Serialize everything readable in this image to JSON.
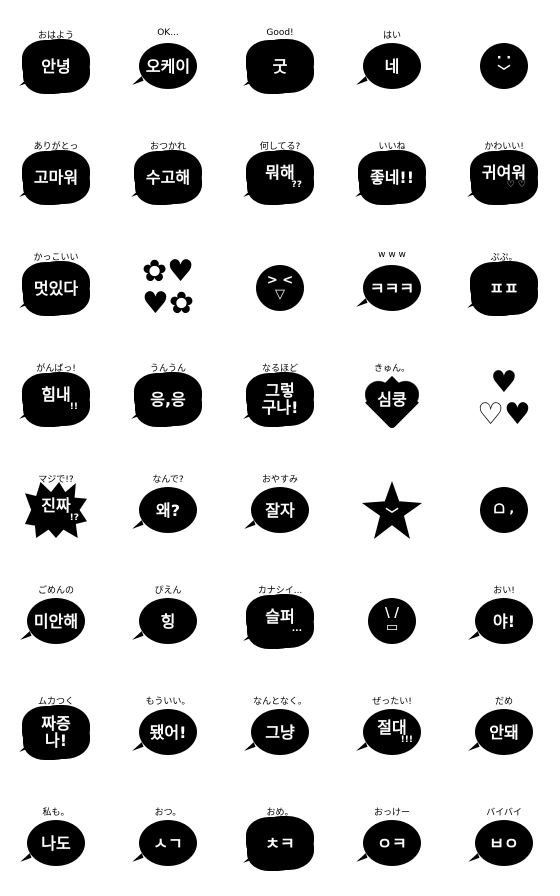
{
  "colors": {
    "ink": "#000000",
    "paper": "#ffffff"
  },
  "stickers": [
    {
      "caption": "おはよう",
      "text": "안녕",
      "sub": "",
      "shape": "cloud"
    },
    {
      "caption": "OK...",
      "text": "오케이",
      "sub": "",
      "shape": "round"
    },
    {
      "caption": "Good!",
      "text": "굿",
      "sub": "",
      "shape": "cloud"
    },
    {
      "caption": "はい",
      "text": "네",
      "sub": "",
      "shape": "round"
    },
    {
      "caption": "",
      "text": "",
      "sub": "",
      "shape": "face",
      "icon": "smile-face-icon",
      "glyph": "· ·\n﹀"
    },
    {
      "caption": "ありがとっ",
      "text": "고마워",
      "sub": "",
      "shape": "cloud"
    },
    {
      "caption": "おつかれ",
      "text": "수고해",
      "sub": "",
      "shape": "cloud"
    },
    {
      "caption": "何してる?",
      "text": "뭐해",
      "sub": "??",
      "shape": "cloud"
    },
    {
      "caption": "いいね",
      "text": "좋네!!",
      "sub": "",
      "shape": "cloud"
    },
    {
      "caption": "かわいい!",
      "text": "귀여워",
      "sub": "♡ ♡",
      "shape": "cloud"
    },
    {
      "caption": "かっこいい",
      "text": "멋있다",
      "sub": "",
      "shape": "cloud"
    },
    {
      "caption": "",
      "text": "",
      "sub": "",
      "shape": "flowers",
      "icon": "flowers-icon",
      "glyph": "✿♥\n♥✿"
    },
    {
      "caption": "",
      "text": "",
      "sub": "",
      "shape": "face",
      "icon": "grin-face-icon",
      "glyph": "> <\n▽"
    },
    {
      "caption": "w w w",
      "text": "ㅋㅋㅋ",
      "sub": "",
      "shape": "round"
    },
    {
      "caption": "ぷぷ。",
      "text": "ㅍㅍ",
      "sub": "",
      "shape": "cloud"
    },
    {
      "caption": "がんばっ!",
      "text": "힘내",
      "sub": "!!",
      "shape": "cloud"
    },
    {
      "caption": "うんうん",
      "text": "응,응",
      "sub": "",
      "shape": "cloud"
    },
    {
      "caption": "なるほど",
      "text": "그렇\n구나!",
      "sub": "",
      "shape": "cloud"
    },
    {
      "caption": "きゅん。",
      "text": "심쿵",
      "sub": "",
      "shape": "heart"
    },
    {
      "caption": "",
      "text": "",
      "sub": "",
      "shape": "hearts",
      "icon": "hearts-icon",
      "glyph": "♥\n♡♥"
    },
    {
      "caption": "マジで!?",
      "text": "진짜",
      "sub": "!?",
      "shape": "burst"
    },
    {
      "caption": "なんで?",
      "text": "왜?",
      "sub": "",
      "shape": "round"
    },
    {
      "caption": "おやすみ",
      "text": "잘자",
      "sub": "",
      "shape": "round"
    },
    {
      "caption": "",
      "text": "",
      "sub": "",
      "shape": "star",
      "icon": "star-face-icon",
      "glyph": "﹀"
    },
    {
      "caption": "",
      "text": "",
      "sub": "",
      "shape": "face",
      "icon": "crying-face-icon",
      "glyph": "ᗝ ‚"
    },
    {
      "caption": "ごめんの",
      "text": "미안해",
      "sub": "",
      "shape": "round"
    },
    {
      "caption": "ぴえん",
      "text": "힝",
      "sub": "",
      "shape": "round"
    },
    {
      "caption": "カナシイ...",
      "text": "슬퍼",
      "sub": "...",
      "shape": "cloud"
    },
    {
      "caption": "",
      "text": "",
      "sub": "",
      "shape": "face",
      "icon": "angry-face-icon",
      "glyph": "\\ /\n▭"
    },
    {
      "caption": "おい!",
      "text": "야!",
      "sub": "",
      "shape": "round"
    },
    {
      "caption": "ムカつく",
      "text": "짜증\n나!",
      "sub": "",
      "shape": "cloud"
    },
    {
      "caption": "もういい。",
      "text": "됐어!",
      "sub": "",
      "shape": "round"
    },
    {
      "caption": "なんとなく。",
      "text": "그냥",
      "sub": "",
      "shape": "round"
    },
    {
      "caption": "ぜったい!",
      "text": "절대",
      "sub": "!!!",
      "shape": "round"
    },
    {
      "caption": "だめ",
      "text": "안돼",
      "sub": "",
      "shape": "round"
    },
    {
      "caption": "私も。",
      "text": "나도",
      "sub": "",
      "shape": "round"
    },
    {
      "caption": "おつ。",
      "text": "ㅅㄱ",
      "sub": "",
      "shape": "round"
    },
    {
      "caption": "おめ。",
      "text": "ㅊㅋ",
      "sub": "",
      "shape": "cloud"
    },
    {
      "caption": "おっけー",
      "text": "ㅇㅋ",
      "sub": "",
      "shape": "round"
    },
    {
      "caption": "バイバイ",
      "text": "ㅂㅇ",
      "sub": "",
      "shape": "round"
    }
  ]
}
